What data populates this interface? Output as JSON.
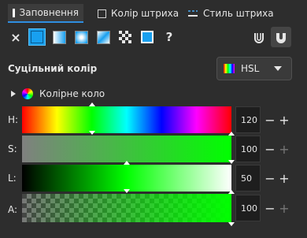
{
  "tabs": [
    {
      "label": "Заповнення",
      "active": true
    },
    {
      "label": "Колір штриха",
      "active": false
    },
    {
      "label": "Стиль штриха",
      "active": false
    }
  ],
  "toolbar": {
    "modes": [
      "none",
      "flat",
      "linear-gradient",
      "radial-gradient",
      "mesh-gradient",
      "pattern",
      "swatch",
      "unset"
    ],
    "unset_label": "?",
    "close_label": "×"
  },
  "section_title": "Суцільний колір",
  "color_mode": {
    "selected": "HSL"
  },
  "color_wheel_label": "Колірне коло",
  "channels": [
    {
      "key": "h",
      "label": "H:",
      "value": "120",
      "fraction": 0.333,
      "dim_plus": false
    },
    {
      "key": "s",
      "label": "S:",
      "value": "100",
      "fraction": 1.0,
      "dim_plus": true
    },
    {
      "key": "l",
      "label": "L:",
      "value": "50",
      "fraction": 0.5,
      "dim_plus": false
    },
    {
      "key": "a",
      "label": "A:",
      "value": "100",
      "fraction": 1.0,
      "dim_plus": true
    }
  ],
  "colors": {
    "accent": "#18a0f0",
    "current": "#00ff00"
  }
}
